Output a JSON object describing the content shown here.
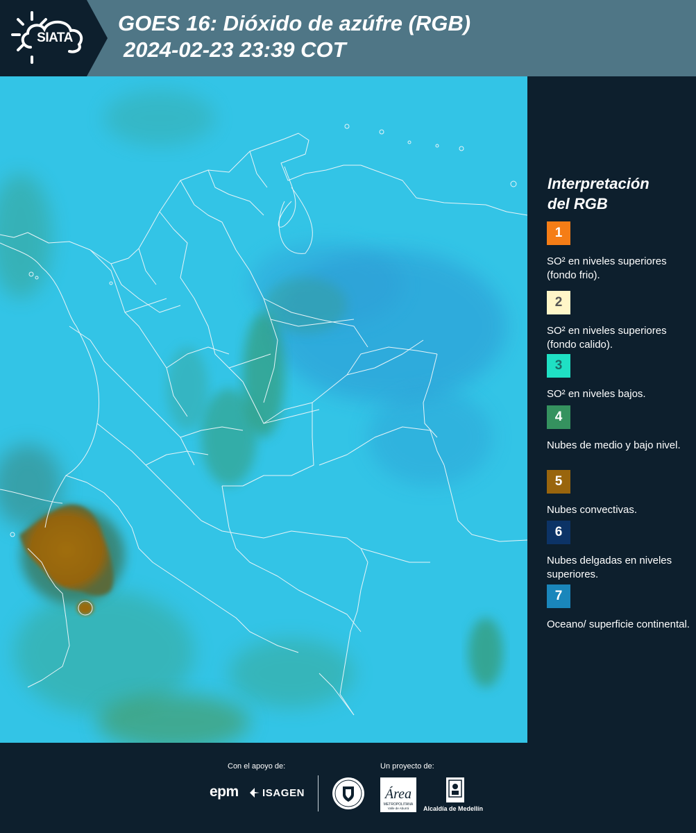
{
  "header": {
    "logo_text": "SIATA",
    "title_line1": "GOES 16: Dióxido de azúfre (RGB)",
    "title_line2": "2024-02-23 23:39 COT"
  },
  "legend": {
    "title_line1": "Interpretación",
    "title_line2": "del RGB",
    "items": [
      {
        "number": "1",
        "label": "SO² en niveles superiores (fondo frio).",
        "color": "#f57d16"
      },
      {
        "number": "2",
        "label": "SO² en niveles superiores (fondo calido).",
        "color": "#fff6c8"
      },
      {
        "number": "3",
        "label": "SO² en niveles bajos.",
        "color": "#1fe0c4"
      },
      {
        "number": "4",
        "label": "Nubes de medio y bajo nivel.",
        "color": "#35925f"
      },
      {
        "number": "5",
        "label": "Nubes convectivas.",
        "color": "#99650d"
      },
      {
        "number": "6",
        "label": "Nubes delgadas en niveles superiores.",
        "color": "#0c3366"
      },
      {
        "number": "7",
        "label": "Oceano/ superficie continental.",
        "color": "#1a86bb"
      }
    ]
  },
  "footer": {
    "support_label": "Con el apoyo de:",
    "project_label": "Un proyecto de:",
    "epm_logo": "epm",
    "isagen_logo": "ISAGEN",
    "area_logo_name": "Área",
    "area_logo_sub1": "METROPOLITANA",
    "area_logo_sub2": "Valle de Aburrá",
    "alcaldia_logo": "Alcaldía de Medellín"
  },
  "map": {
    "ocean_color": "#33c4e6",
    "land_color": "#3ab7e0",
    "cloud_color": "#35925f",
    "convective_color": "#99650d",
    "border_color": "#e8f4f8"
  }
}
